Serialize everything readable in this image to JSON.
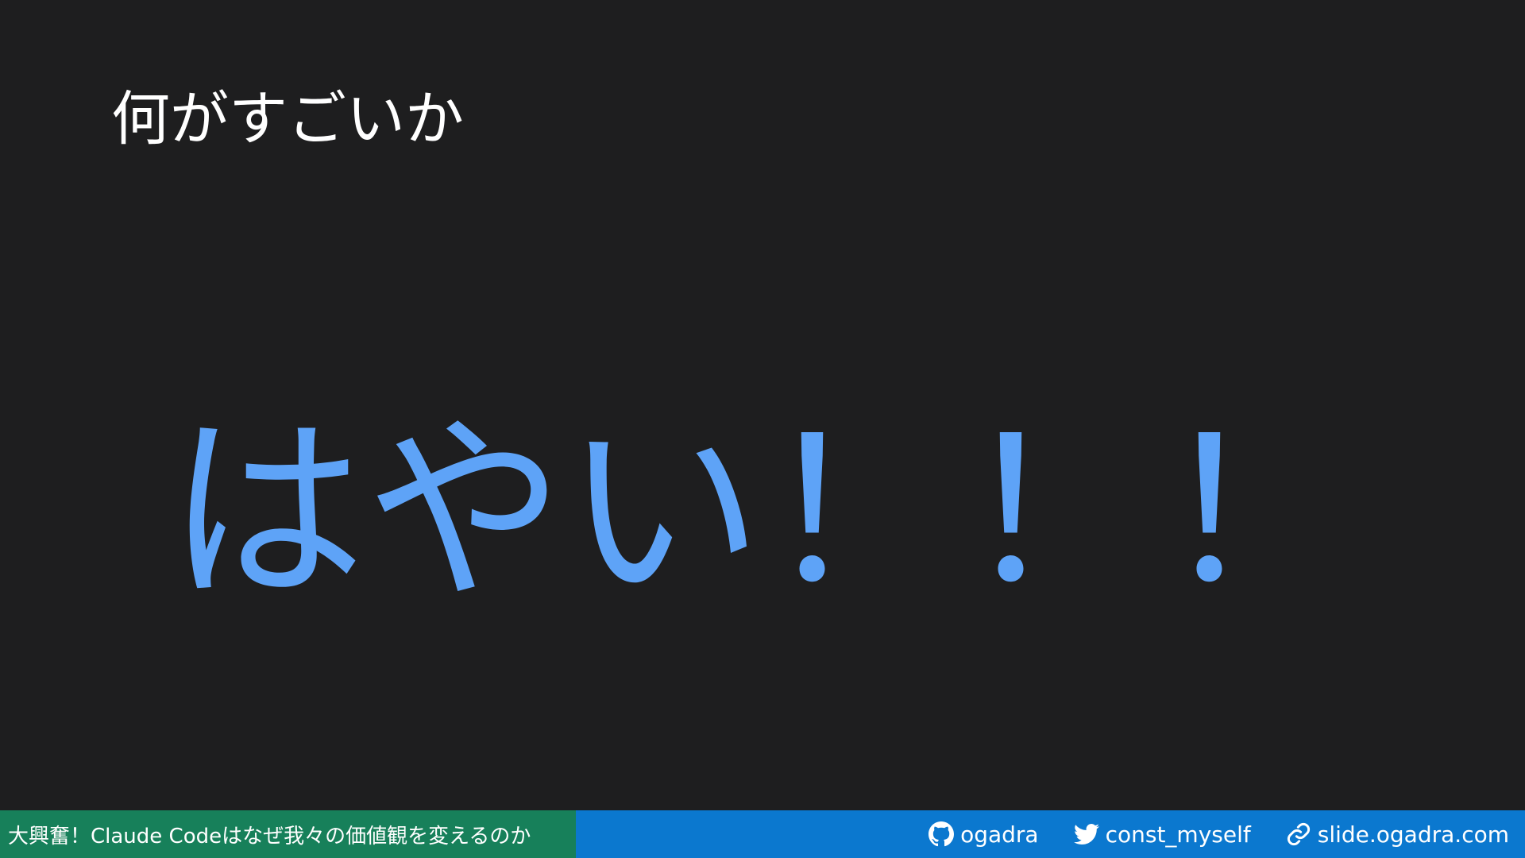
{
  "slide": {
    "title": "何がすごいか",
    "headline": "はやい！！！"
  },
  "footer": {
    "deck_title": "大興奮！Claude Codeはなぜ我々の価値観を変えるのか",
    "links": [
      {
        "icon": "github-icon",
        "label": "ogadra"
      },
      {
        "icon": "twitter-icon",
        "label": "const_myself"
      },
      {
        "icon": "link-icon",
        "label": "slide.ogadra.com"
      }
    ]
  },
  "colors": {
    "background": "#1e1e1f",
    "headline": "#5ea3f7",
    "footer_bar": "#0b78cf",
    "footer_title_bg": "#17805a"
  }
}
